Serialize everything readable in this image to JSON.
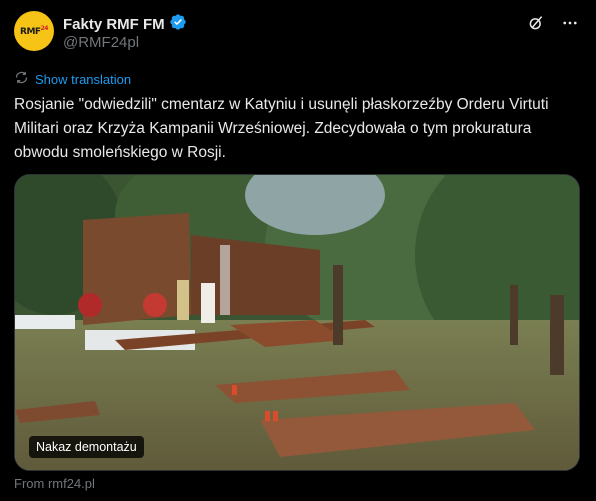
{
  "account": {
    "name": "Fakty RMF FM",
    "handle": "@RMF24pl",
    "verified": true,
    "avatar_text": "RMF",
    "avatar_sup": "24"
  },
  "actions": {
    "grok_icon": "grok-icon",
    "more_icon": "more-icon"
  },
  "translation": {
    "label": "Show translation"
  },
  "tweet": {
    "text": "Rosjanie \"odwiedzili\" cmentarz w Katyniu i usunęli płaskorzeźby Orderu Virtuti Militari oraz Krzyża Kampanii Wrześniowej. Zdecydowała o tym prokuratura obwodu smoleńskiego w Rosji."
  },
  "media": {
    "caption": "Nakaz demontażu"
  },
  "source": {
    "label": "From rmf24.pl"
  },
  "colors": {
    "accent": "#1d9bf0",
    "verified": "#1d9bf0",
    "avatar_bg": "#f6c317"
  }
}
